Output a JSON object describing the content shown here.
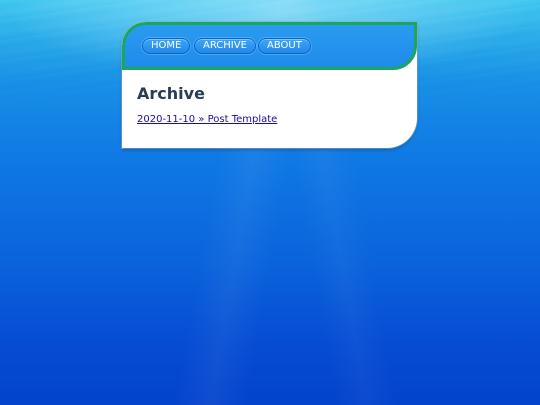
{
  "nav": {
    "home_label": "HOME",
    "archive_label": "ARCHIVE",
    "about_label": "ABOUT"
  },
  "main": {
    "title": "Archive",
    "posts": [
      {
        "label": "2020-11-10 » Post Template"
      }
    ]
  },
  "colors": {
    "nav_background": "#1f8beb",
    "nav_border": "#17a85e",
    "title_text": "#283c53",
    "link_text": "#1a0dab",
    "page_background": "#0a63dc"
  }
}
